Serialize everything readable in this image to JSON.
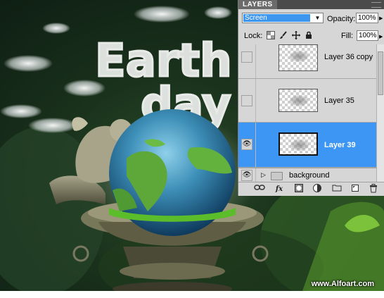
{
  "artwork": {
    "title_lines": [
      "Earth",
      "day"
    ],
    "credit": "www.Alfoart.com"
  },
  "panel": {
    "tab_label": "LAYERS",
    "blend_mode": "Screen",
    "opacity_label": "Opacity:",
    "opacity_value": "100%",
    "lock_label": "Lock:",
    "fill_label": "Fill:",
    "fill_value": "100%",
    "layers": [
      {
        "name": "Layer 36 copy",
        "visible": false,
        "selected": false
      },
      {
        "name": "Layer 35",
        "visible": false,
        "selected": false
      },
      {
        "name": "Layer 39",
        "visible": true,
        "selected": true
      }
    ],
    "group": {
      "name": "background",
      "visible": true
    },
    "colors": {
      "selection": "#3d96f3",
      "panel": "#d6d6d6",
      "blend_highlight": "#3e97ef"
    },
    "bottom_icons": [
      "link-icon",
      "fx-icon",
      "layer-mask-icon",
      "adjustment-layer-icon",
      "new-group-icon",
      "new-layer-icon",
      "trash-icon"
    ],
    "lock_icons": [
      "lock-transparency-icon",
      "lock-brush-icon",
      "lock-move-icon",
      "lock-all-icon"
    ]
  }
}
